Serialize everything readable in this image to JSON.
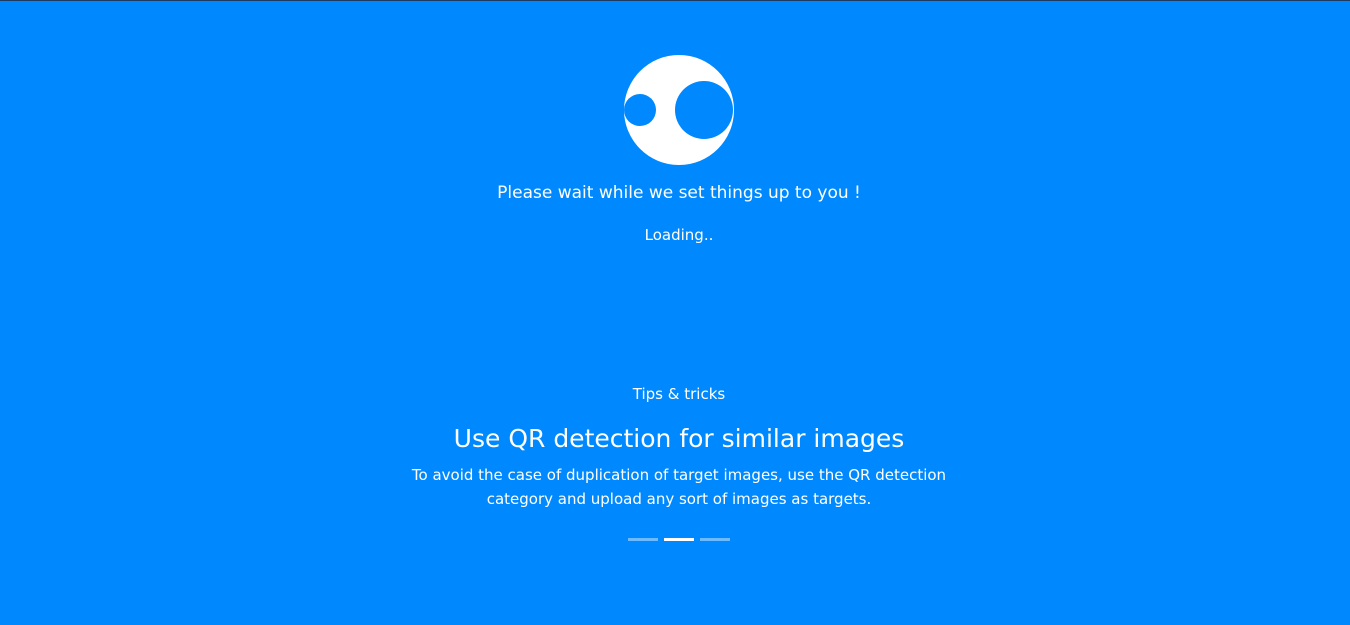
{
  "loader": {
    "message": "Please wait while we set things up to you !",
    "status": "Loading.."
  },
  "tips": {
    "label": "Tips & tricks",
    "title": "Use QR detection for similar images",
    "description": "To avoid the case of duplication of target images, use the QR detection category and upload any sort of images as targets.",
    "active_index": 1,
    "count": 3
  },
  "colors": {
    "background": "#0089ff",
    "foreground": "#ffffff",
    "indicator_inactive": "#6cbaff"
  },
  "icons": {
    "logo": "eyes-logo-icon"
  }
}
